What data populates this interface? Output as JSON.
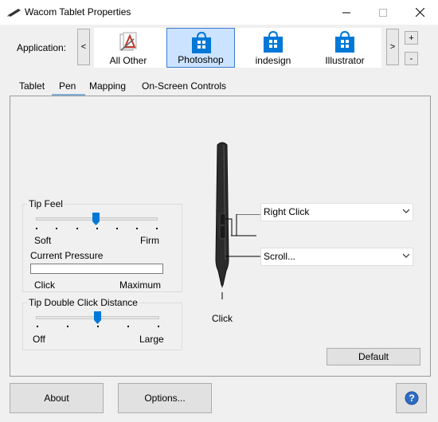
{
  "window": {
    "title": "Wacom Tablet Properties",
    "minimize": "–",
    "maximize": "☐",
    "close": "✕"
  },
  "application": {
    "label": "Application:",
    "prev": "<",
    "next": ">",
    "add": "+",
    "remove": "-",
    "tiles": [
      {
        "label": "All Other",
        "icon": "all-other-icon"
      },
      {
        "label": "Photoshop",
        "icon": "store-app-icon"
      },
      {
        "label": "indesign",
        "icon": "store-app-icon"
      },
      {
        "label": "Illustrator",
        "icon": "store-app-icon"
      }
    ],
    "selected_index": 1
  },
  "tabs": {
    "items": [
      "Tablet",
      "Pen",
      "Mapping",
      "On-Screen Controls"
    ],
    "active_index": 1
  },
  "pen": {
    "tip_feel": {
      "title": "Tip Feel",
      "min_label": "Soft",
      "max_label": "Firm",
      "position_ticks": 3,
      "tick_count": 7
    },
    "current_pressure": {
      "label": "Current Pressure",
      "min_label": "Click",
      "max_label": "Maximum",
      "level": 0
    },
    "double_click": {
      "title": "Tip Double Click Distance",
      "min_label": "Off",
      "max_label": "Large",
      "position_ticks": 2,
      "tick_count": 5
    },
    "upper_button": "Right Click",
    "lower_button": "Scroll...",
    "tip_label": "Click",
    "default_button": "Default"
  },
  "footer": {
    "about": "About",
    "options": "Options...",
    "help": "?"
  },
  "colors": {
    "selected_tile": "#cce3ff",
    "accent": "#0078d7",
    "help_blue": "#2f6dc4"
  }
}
